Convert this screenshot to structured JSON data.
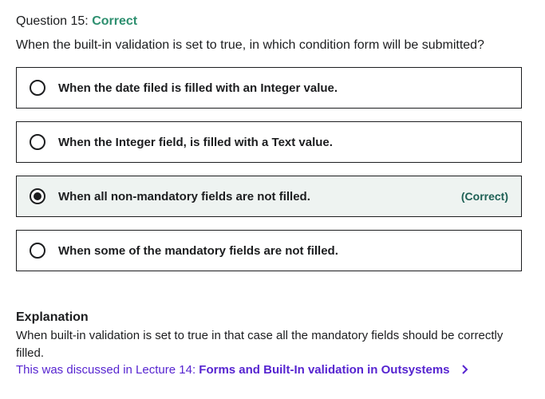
{
  "question": {
    "prefix": "Question 15:",
    "status": "Correct",
    "text": "When the built-in validation is set to true, in which condition form will be submitted?"
  },
  "options": [
    {
      "label": "When the date filed is filled with an Integer value.",
      "selected": false,
      "tag": ""
    },
    {
      "label": "When the Integer field, is filled with a Text value.",
      "selected": false,
      "tag": ""
    },
    {
      "label": "When all non-mandatory fields are not filled.",
      "selected": true,
      "tag": "(Correct)"
    },
    {
      "label": "When some of the mandatory fields are not filled.",
      "selected": false,
      "tag": ""
    }
  ],
  "explanation": {
    "title": "Explanation",
    "body": "When built-in validation is set to true in that case all the mandatory fields should be correctly filled.",
    "lecture_prefix": "This was discussed in Lecture 14:",
    "lecture_link": "Forms and Built-In validation in Outsystems",
    "chevron_icon": "chevron-right-icon"
  },
  "colors": {
    "correct_green": "#2d8f6f",
    "link_purple": "#5624d0",
    "selected_bg": "#eef3f1"
  }
}
